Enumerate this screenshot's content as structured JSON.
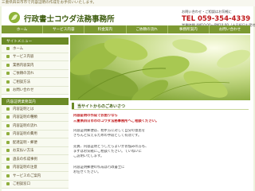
{
  "topbar": {
    "tagline": "三重県四日市市で内容証明の作成をお手伝いいたします。"
  },
  "header": {
    "title": "行政書士コウダ法務事務所",
    "contact_label": "お問い合わせ・ご相談はお気軽に",
    "tel": "TEL  059-354-4339",
    "hours": "営業時間 AM10:00～PM10:00（土日祝日も受付）"
  },
  "nav": [
    "ホーム",
    "サービス内容",
    "料金案内",
    "ご依頼の流れ",
    "事務所案内",
    "お問い合わせ"
  ],
  "sidebar": {
    "menu_head": "サイトメニュー",
    "menu": [
      "ホーム",
      "サービス内容",
      "業務内容案内",
      "ご依頼の流れ",
      "ご相談方法",
      "お問い合わせ"
    ],
    "cert_head": "内容証明業務案内",
    "cert": [
      "内容証明とは",
      "内容証明の種類",
      "内容証明の流れ",
      "内容証明の費用",
      "配達証明・郵便",
      "お支払い方法",
      "過去の作成事例",
      "内容証明の注意",
      "サービスのご案内",
      "ご相談窓口"
    ]
  },
  "main": {
    "section_title": "当サイトからのごあいさつ",
    "intro_1": "内容証明の作成でお困りなら",
    "intro_2": "三重県四日市市のコウダ法務事務所へご相談ください。",
    "p1": [
      "内容証明郵便は、相手方に対して自分の意思を",
      "きちんと伝えるための手段として有効です。"
    ],
    "p2": [
      "売買、内容証明どうしたらよいかお悩みの方も、",
      "まずはお気軽にご相談ください。ていねいに",
      "ご説明いたします。"
    ],
    "p3": [
      "内容証明郵便の作成は行政書士に",
      "お任せください。"
    ]
  },
  "colors": {
    "accent": "#6b8a26",
    "nav": "#7d9a32",
    "tel": "#c0191b"
  }
}
